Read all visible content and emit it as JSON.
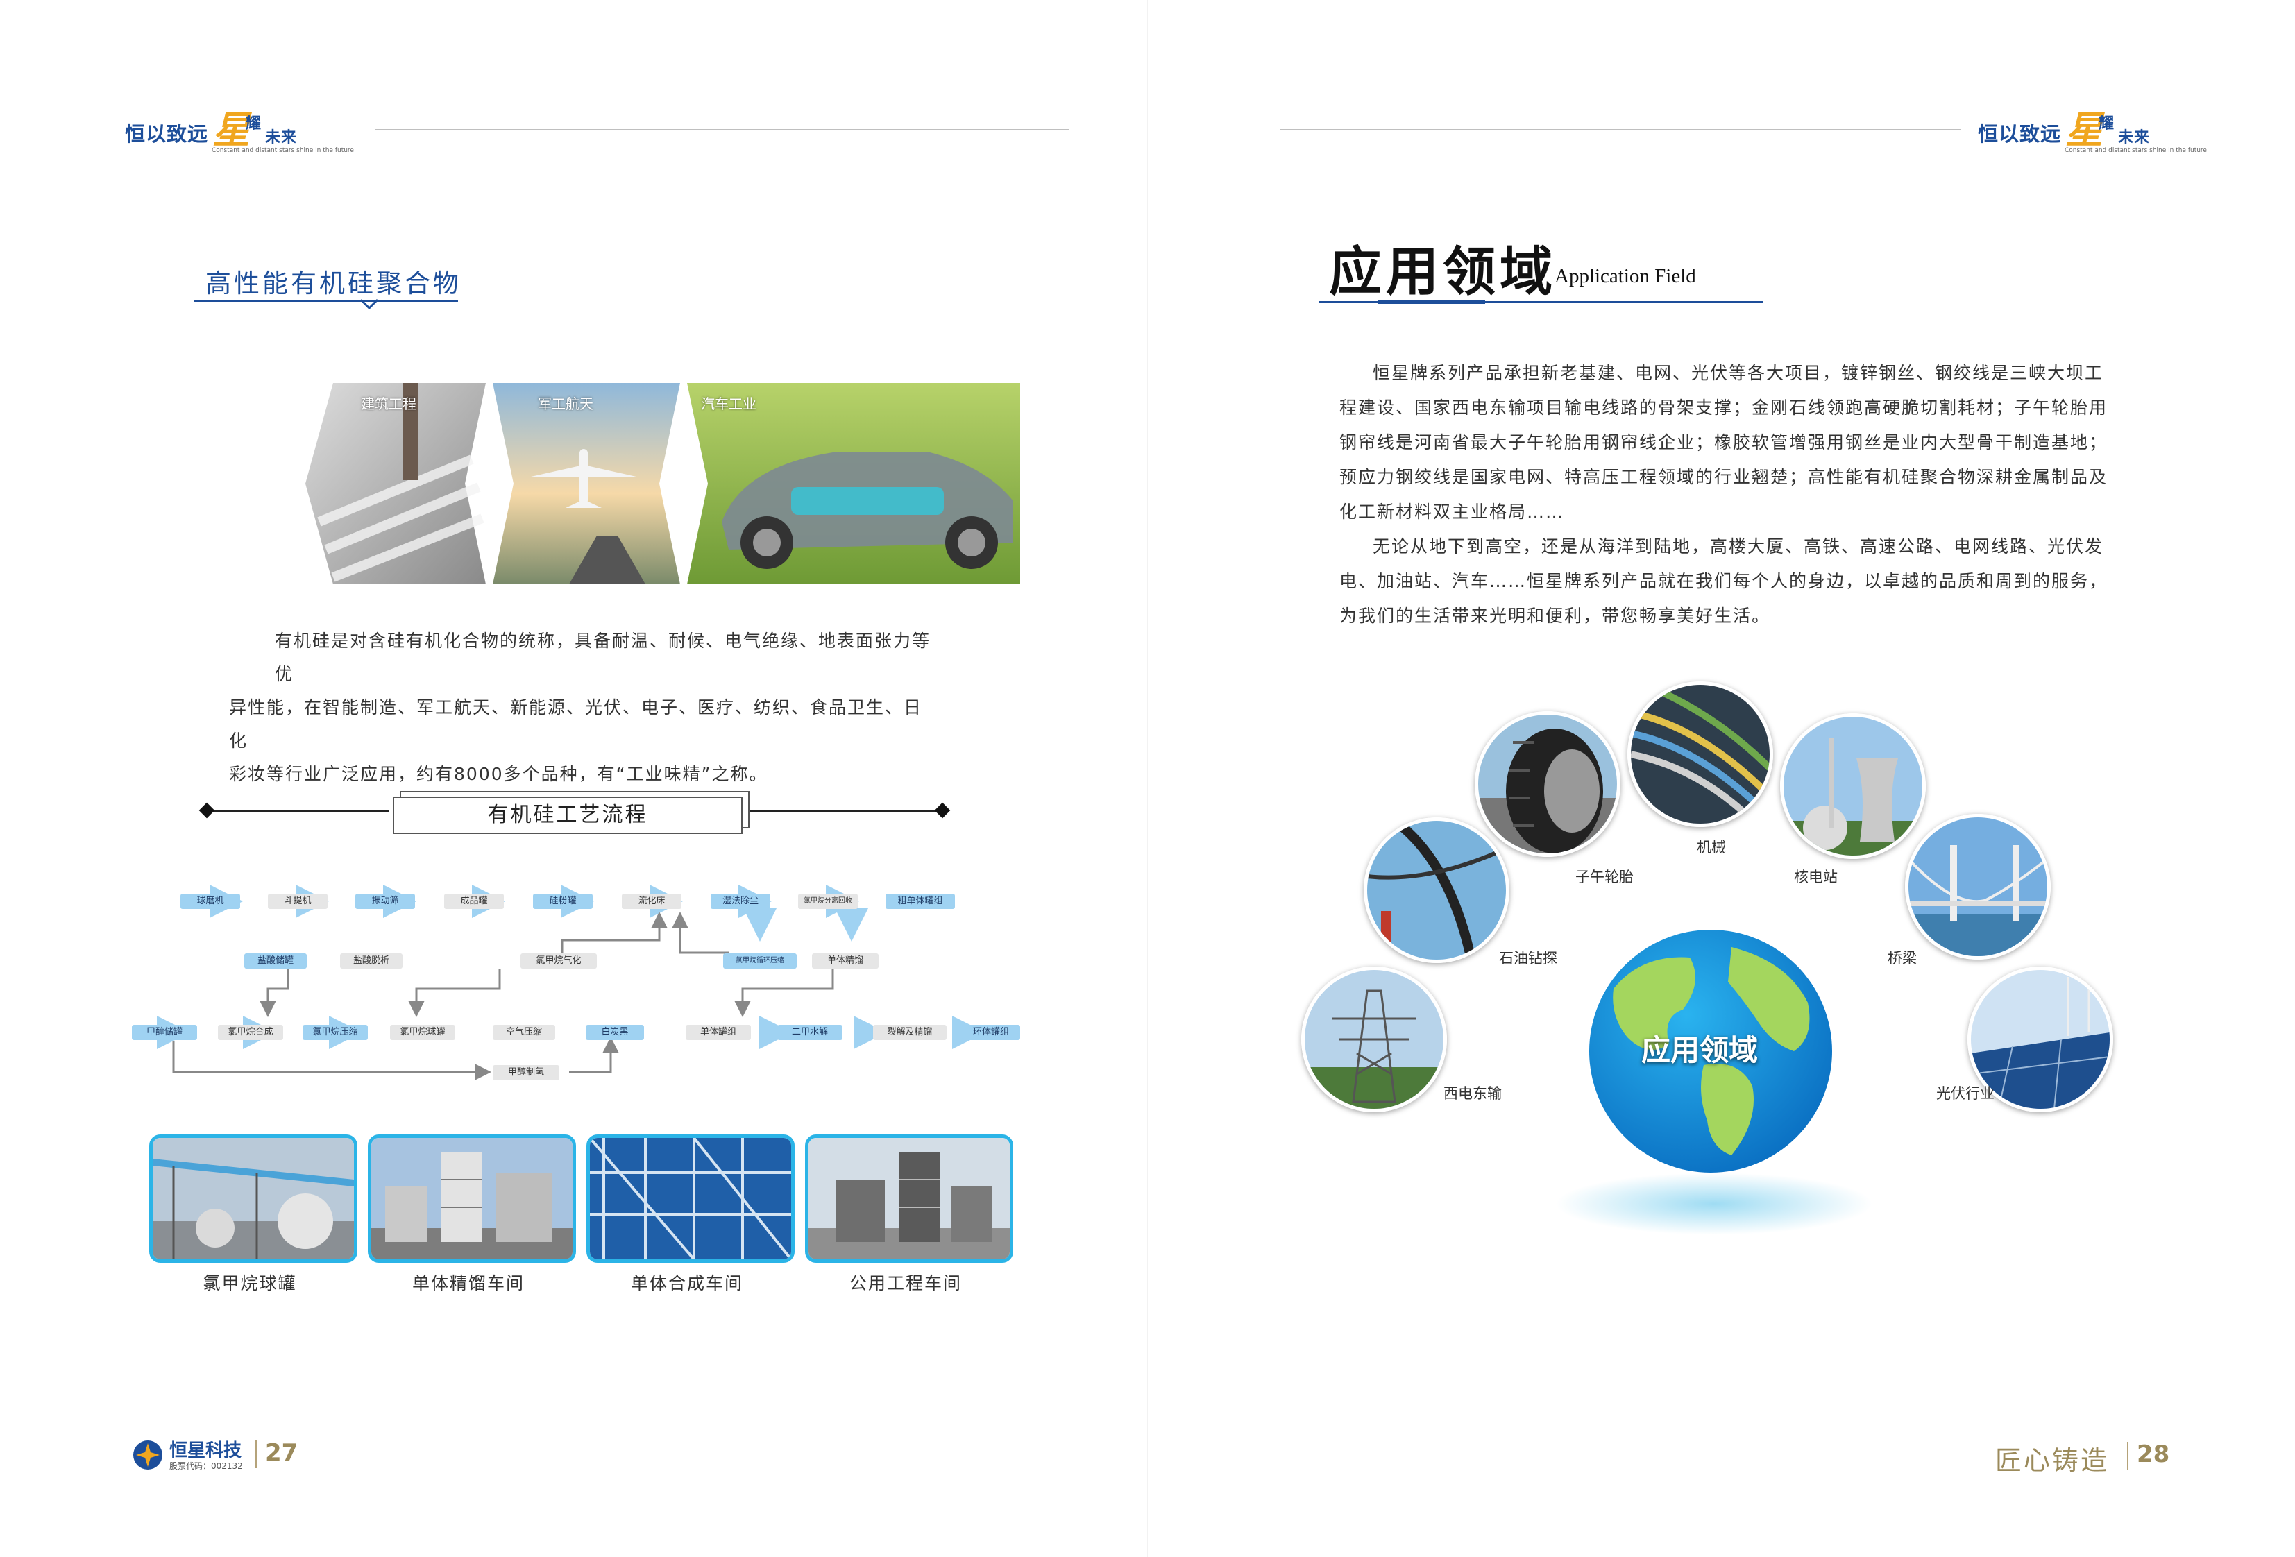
{
  "header": {
    "slogan_main": "恒以致远",
    "slogan_star": "星",
    "slogan_wei": "耀",
    "slogan_future": "未来",
    "slogan_en": "Constant and distant stars shine in the future"
  },
  "left": {
    "section_title": "高性能有机硅聚合物",
    "collage_labels": [
      "建筑工程",
      "军工航天",
      "汽车工业"
    ],
    "intro_lines": [
      "有机硅是对含硅有机化合物的统称，具备耐温、耐候、电气绝缘、地表面张力等优",
      "异性能，在智能制造、军工航天、新能源、光伏、电子、医疗、纺织、食品卫生、日化",
      "彩妆等行业广泛应用，约有8000多个品种，有“工业味精”之称。"
    ],
    "flow_title": "有机硅工艺流程",
    "flow": {
      "row1": [
        "球磨机",
        "斗提机",
        "振动筛",
        "成品罐",
        "硅粉罐",
        "流化床",
        "湿法除尘",
        "氯甲烷分离回收",
        "粗单体罐组"
      ],
      "row2": [
        "盐酸储罐",
        "盐酸脱析",
        "氯甲烷气化",
        "氯甲烷循环压缩",
        "单体精馏"
      ],
      "row3": [
        "甲醇储罐",
        "氯甲烷合成",
        "氯甲烷压缩",
        "氯甲烷球罐",
        "空气压缩",
        "白炭黑",
        "单体罐组",
        "二甲水解",
        "裂解及精馏",
        "环体罐组"
      ],
      "row4": [
        "甲醇制氢"
      ]
    },
    "photos": [
      "氯甲烷球罐",
      "单体精馏车间",
      "单体合成车间",
      "公用工程车间"
    ]
  },
  "right": {
    "title_cn": "应用领域",
    "title_en": "Application Field",
    "para1_lines": [
      "恒星牌系列产品承担新老基建、电网、光伏等各大项目，镀锌钢丝、钢绞线是三峡大坝工",
      "程建设、国家西电东输项目输电线路的骨架支撑；金刚石线领跑高硬脆切割耗材；子午轮胎用",
      "钢帘线是河南省最大子午轮胎用钢帘线企业；橡胶软管增强用钢丝是业内大型骨干制造基地；",
      "预应力钢绞线是国家电网、特高压工程领域的行业翘楚；高性能有机硅聚合物深耕金属制品及",
      "化工新材料双主业格局……"
    ],
    "para2_lines": [
      "无论从地下到高空，还是从海洋到陆地，高楼大厦、高铁、高速公路、电网线路、光伏发",
      "电、加油站、汽车……恒星牌系列产品就在我们每个人的身边，以卓越的品质和周到的服务，",
      "为我们的生活带来光明和便利，带您畅享美好生活。"
    ],
    "globe_label": "应用领域",
    "fields": [
      "西电东输",
      "石油钻探",
      "子午轮胎",
      "机械",
      "核电站",
      "桥梁",
      "光伏行业"
    ]
  },
  "footer_left": {
    "company": "恒星科技",
    "stock": "股票代码：002132",
    "page": "27"
  },
  "footer_right": {
    "motto": "匠心铸造",
    "page": "28"
  }
}
